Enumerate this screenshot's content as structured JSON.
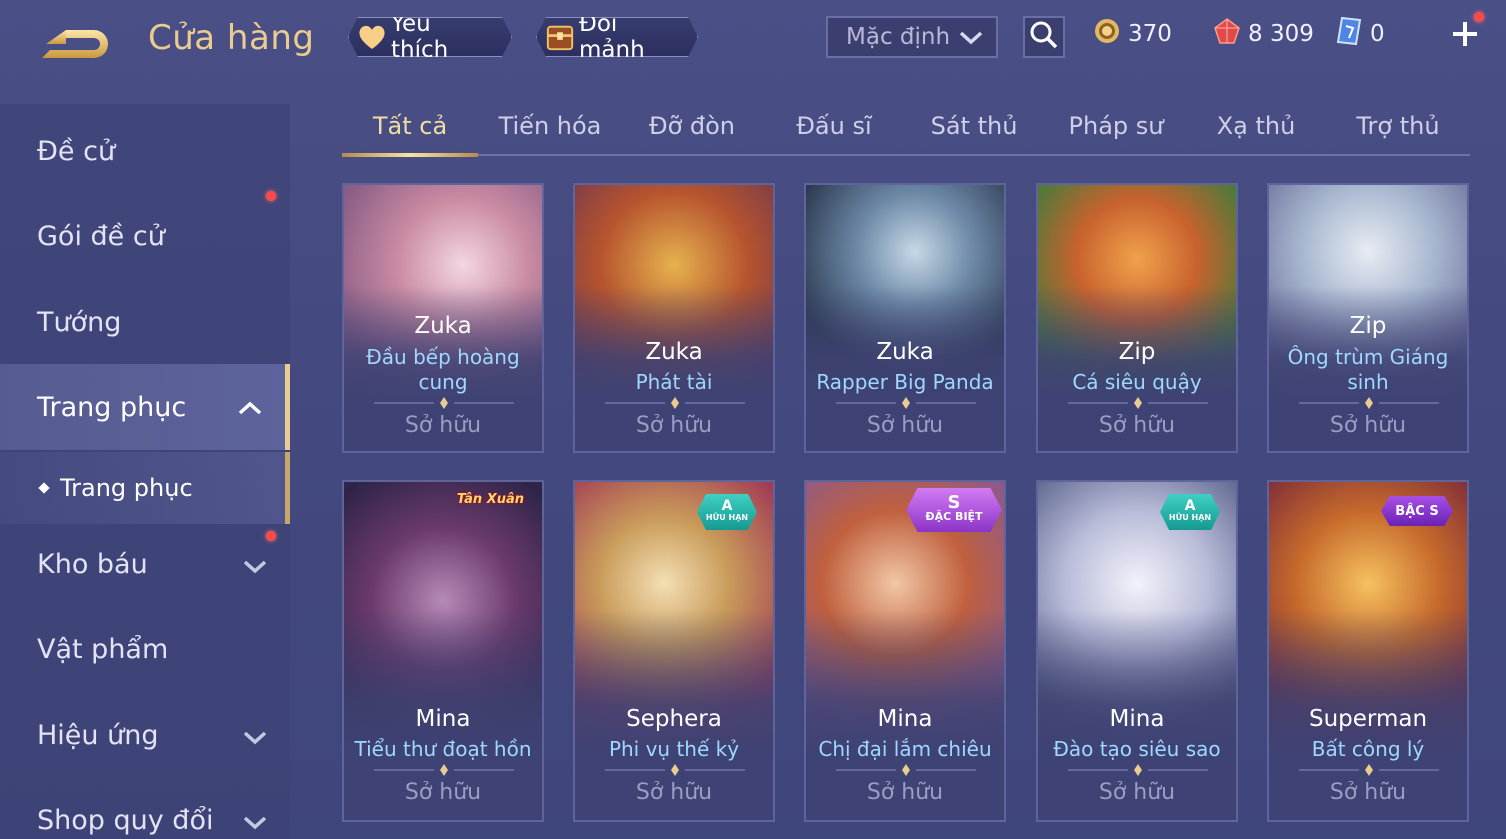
{
  "header": {
    "title": "Cửa hàng",
    "favorites_label": "Yêu thích",
    "exchange_label": "Đổi mảnh",
    "sort_label": "Mặc định",
    "currencies": {
      "gold": "370",
      "ruby": "8 309",
      "ticket": "0"
    },
    "colors": {
      "title": "#e9cc8f",
      "accent": "#f2dca6",
      "notification": "#ff4a4a"
    }
  },
  "sidebar": {
    "items": [
      {
        "label": "Đề cử"
      },
      {
        "label": "Gói đề cử"
      },
      {
        "label": "Tướng"
      },
      {
        "label": "Trang phục"
      },
      {
        "label": "Trang phục"
      },
      {
        "label": "Kho báu"
      },
      {
        "label": "Vật phẩm"
      },
      {
        "label": "Hiệu ứng"
      },
      {
        "label": "Shop quy đổi"
      }
    ]
  },
  "tabs": [
    {
      "label": "Tất cả"
    },
    {
      "label": "Tiến hóa"
    },
    {
      "label": "Đỡ đòn"
    },
    {
      "label": "Đấu sĩ"
    },
    {
      "label": "Sát thủ"
    },
    {
      "label": "Pháp sư"
    },
    {
      "label": "Xạ thủ"
    },
    {
      "label": "Trợ thủ"
    }
  ],
  "cards": [
    {
      "hero": "Zuka",
      "skin": "Đầu bếp hoàng cung",
      "status": "Sở hữu"
    },
    {
      "hero": "Zuka",
      "skin": "Phát tài",
      "status": "Sở hữu"
    },
    {
      "hero": "Zuka",
      "skin": "Rapper Big Panda",
      "status": "Sở hữu"
    },
    {
      "hero": "Zip",
      "skin": "Cá siêu quậy",
      "status": "Sở hữu"
    },
    {
      "hero": "Zip",
      "skin": "Ông trùm Giáng sinh",
      "status": "Sở hữu"
    },
    {
      "hero": "Mina",
      "skin": "Tiểu thư đoạt hồn",
      "status": "Sở hữu",
      "badge": "Tân Xuân"
    },
    {
      "hero": "Sephera",
      "skin": "Phi vụ thế kỷ",
      "status": "Sở hữu",
      "badge_top": "A",
      "badge_bottom": "HỮU HẠN"
    },
    {
      "hero": "Mina",
      "skin": "Chị đại lắm chiêu",
      "status": "Sở hữu",
      "badge_top": "S",
      "badge_bottom": "ĐẶC BIỆT"
    },
    {
      "hero": "Mina",
      "skin": "Đào tạo siêu sao",
      "status": "Sở hữu",
      "badge_top": "A",
      "badge_bottom": "HỮU HẠN"
    },
    {
      "hero": "Superman",
      "skin": "Bất công lý",
      "status": "Sở hữu",
      "badge": "BẬC S"
    }
  ]
}
